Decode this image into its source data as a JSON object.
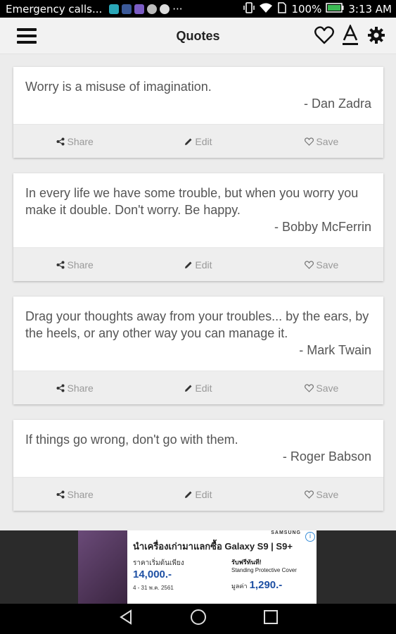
{
  "status_bar": {
    "notification": "Emergency calls...",
    "more": "···",
    "battery": "100%",
    "time": "3:13 AM"
  },
  "toolbar": {
    "title": "Quotes"
  },
  "cards": [
    {
      "quote": "Worry is a misuse of imagination.",
      "author": "- Dan Zadra",
      "share": "Share",
      "edit": "Edit",
      "save": "Save"
    },
    {
      "quote": "In every life we have some trouble, but when you worry you make it double. Don't worry. Be happy.",
      "author": "- Bobby McFerrin",
      "share": "Share",
      "edit": "Edit",
      "save": "Save"
    },
    {
      "quote": "Drag your thoughts away from your troubles... by the ears, by the heels, or any other way you can manage it.",
      "author": "- Mark Twain",
      "share": "Share",
      "edit": "Edit",
      "save": "Save"
    },
    {
      "quote": "If things go wrong, don't go with them.",
      "author": "- Roger Babson",
      "share": "Share",
      "edit": "Edit",
      "save": "Save"
    }
  ],
  "ad": {
    "brand": "SAMSUNG",
    "headline": "นำเครื่องเก่ามาแลกซื้อ Galaxy S9 | S9+",
    "price_label": "ราคาเริ่มต้นเพียง",
    "price": "14,000.-",
    "dates": "4 - 31 พ.ค. 2561",
    "gift_title": "รับฟรีทันที!",
    "gift_item": "Standing Protective Cover",
    "gift_value_label": "มูลค่า",
    "gift_value": "1,290.-"
  }
}
